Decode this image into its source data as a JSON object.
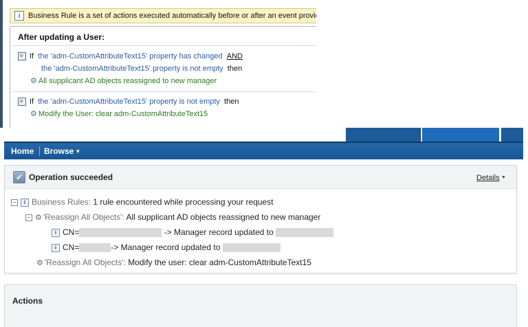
{
  "rule_editor": {
    "info_text": "Business Rule is a set of actions executed automatically before or after an event provid",
    "section_title": "After updating a User:",
    "rules": [
      {
        "if_label": "If",
        "condition1": "the 'adm-CustomAttributeText15' property has changed",
        "conjunction": "AND",
        "condition2": "the 'adm-CustomAttributeText15' property is not empty",
        "then_label": "then",
        "action": "All supplicant AD objects reassigned to new manager"
      },
      {
        "if_label": "If",
        "condition1": "the 'adm-CustomAttributeText15' property is not empty",
        "then_label": "then",
        "action": "Modify the User: clear adm-CustomAttributeText15"
      }
    ]
  },
  "nav": {
    "home": "Home",
    "browse": "Browse"
  },
  "result": {
    "status_title": "Operation succeeded",
    "details_label": "Details",
    "business_rules_label": "Business Rules:",
    "business_rules_text": "1 rule encountered while processing your request",
    "rule1_name": "'Reassign All Objects':",
    "rule1_text": "All supplicant AD objects reassigned to new manager",
    "entry1_prefix": "CN=",
    "entry1_text": "-> Manager record updated to",
    "entry2_prefix": "CN=",
    "entry2_text": "-> Manager record updated to",
    "rule2_name": "'Reassign All Objects':",
    "rule2_text": "Modify the user: clear adm-CustomAttributeText15"
  },
  "actions": {
    "title": "Actions"
  },
  "icons": {
    "info": "info-icon",
    "condition": "condition-icon",
    "gear": "gear-icon",
    "collapse": "collapse-minus-icon",
    "success": "check-icon"
  },
  "colors": {
    "nav_bar": "#1f5d9e",
    "condition_link": "#2c5aa8",
    "action_text": "#2c7a22",
    "info_banner": "#fbf3c6"
  }
}
